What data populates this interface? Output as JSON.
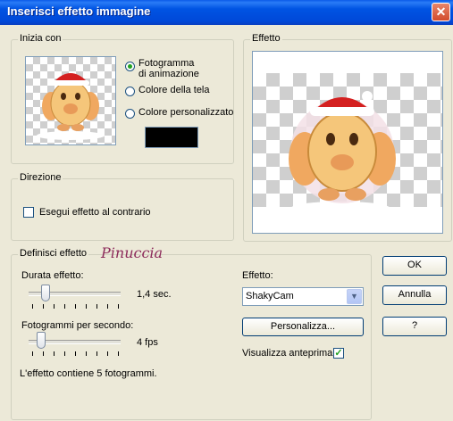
{
  "window": {
    "title": "Inserisci effetto immagine"
  },
  "start_group": {
    "legend": "Inizia con",
    "options": [
      {
        "label": "Fotogramma\ndi animazione",
        "selected": true
      },
      {
        "label": "Colore della tela",
        "selected": false
      },
      {
        "label": "Colore personalizzato",
        "selected": false
      }
    ],
    "custom_color": "#000000"
  },
  "effect_group": {
    "legend": "Effetto"
  },
  "direction_group": {
    "legend": "Direzione",
    "reverse_label": "Esegui effetto al contrario",
    "reverse_checked": false
  },
  "define_group": {
    "legend": "Definisci effetto",
    "duration_label": "Durata effetto:",
    "duration_value": "1,4 sec.",
    "fps_label": "Fotogrammi per secondo:",
    "fps_value": "4 fps",
    "frame_info": "L'effetto contiene 5 fotogrammi.",
    "effect_label": "Effetto:",
    "effect_selected": "ShakyCam",
    "customize_label": "Personalizza...",
    "preview_label": "Visualizza anteprima",
    "preview_checked": true
  },
  "watermark": "Pinuccia",
  "buttons": {
    "ok": "OK",
    "cancel": "Annulla",
    "help": "?"
  },
  "icons": {
    "close": "close-icon",
    "check": "check-icon",
    "dropdown": "chevron-down-icon"
  }
}
